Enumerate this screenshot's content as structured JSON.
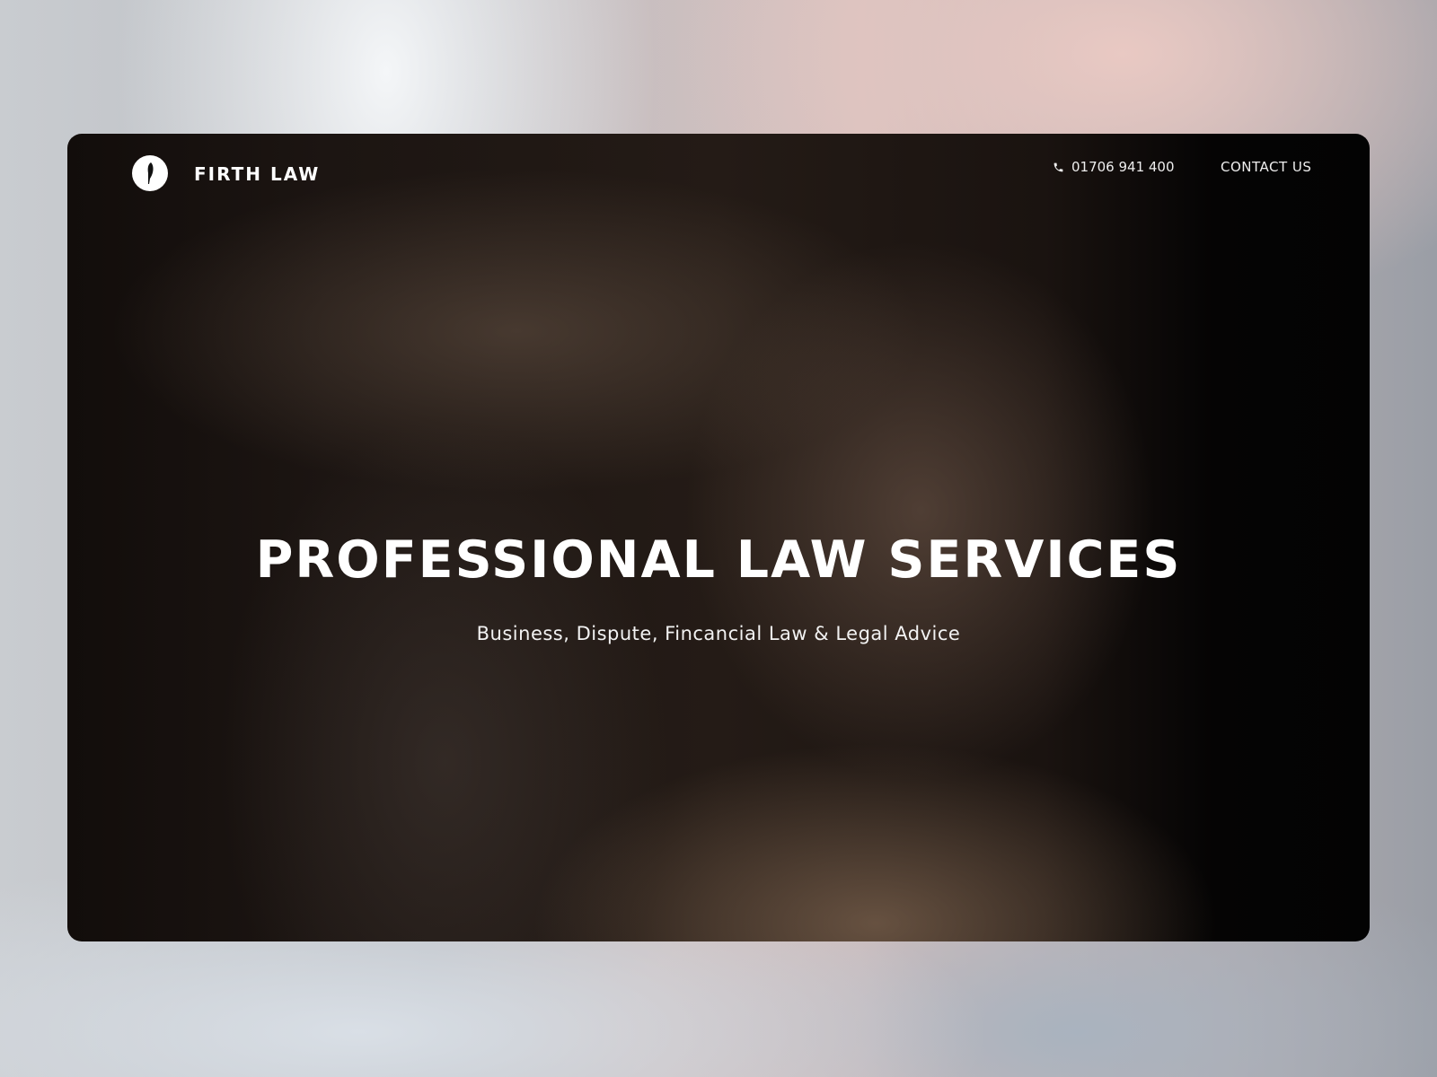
{
  "header": {
    "brand": "FIRTH LAW",
    "logo_icon": "quill-icon",
    "phone": "01706 941 400",
    "phone_icon": "phone-icon",
    "contact_label": "CONTACT US"
  },
  "hero": {
    "title": "PROFESSIONAL LAW SERVICES",
    "subtitle": "Business, Dispute, Fincancial Law & Legal Advice"
  }
}
